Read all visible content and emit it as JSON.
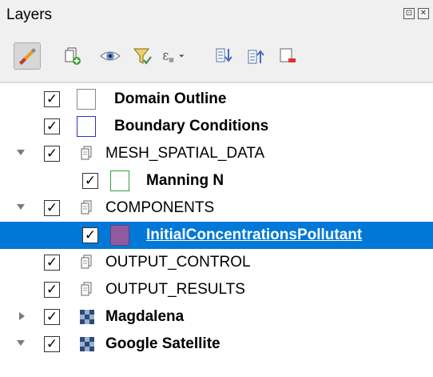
{
  "panel": {
    "title": "Layers",
    "float_button": "⊡",
    "close_button": "✕"
  },
  "toolbar": {
    "buttons": [
      {
        "name": "style-manager-icon",
        "active": true
      },
      {
        "name": "add-group-icon"
      },
      {
        "name": "visibility-eye-icon"
      },
      {
        "name": "filter-legend-icon"
      },
      {
        "name": "filter-expression-icon"
      },
      {
        "name": "expand-all-icon"
      },
      {
        "name": "collapse-all-icon"
      },
      {
        "name": "remove-layer-icon"
      }
    ]
  },
  "layers": [
    {
      "label": "Domain Outline",
      "bold": true,
      "checked": true,
      "checkmark": "✓",
      "icon": "swatch",
      "swatch_border": "#888888",
      "swatch_fill": "#ffffff"
    },
    {
      "label": "Boundary Conditions",
      "bold": true,
      "checked": true,
      "checkmark": "✓",
      "icon": "swatch",
      "swatch_border": "#2d2dd8",
      "swatch_fill": "#ffffff"
    },
    {
      "label": "MESH_SPATIAL_DATA",
      "bold": false,
      "checked": true,
      "checkmark": "✓",
      "icon": "group",
      "expander": "expanded"
    },
    {
      "label": "Manning N",
      "bold": true,
      "checked": true,
      "checkmark": "✓",
      "icon": "swatch",
      "swatch_border": "#3a9a3a",
      "swatch_fill": "#ffffff"
    },
    {
      "label": "COMPONENTS",
      "bold": false,
      "checked": true,
      "checkmark": "✓",
      "icon": "group",
      "expander": "expanded"
    },
    {
      "label": "InitialConcentrationsPollutant",
      "bold": true,
      "checked": true,
      "checkmark": "✓",
      "icon": "swatch",
      "swatch_border": "#6a3d7a",
      "swatch_fill": "#8f5a9e",
      "selected": true
    },
    {
      "label": "OUTPUT_CONTROL",
      "bold": false,
      "checked": true,
      "checkmark": "✓",
      "icon": "group"
    },
    {
      "label": "OUTPUT_RESULTS",
      "bold": false,
      "checked": true,
      "checkmark": "✓",
      "icon": "group"
    },
    {
      "label": "Magdalena",
      "bold": true,
      "checked": true,
      "checkmark": "✓",
      "icon": "raster",
      "expander": "collapsed"
    },
    {
      "label": "Google Satellite",
      "bold": true,
      "checked": true,
      "checkmark": "✓",
      "icon": "raster",
      "expander": "expanded"
    }
  ],
  "colors": {
    "selection": "#0078d7",
    "panel_bg": "#f0f0f0",
    "tree_bg": "#ffffff"
  }
}
